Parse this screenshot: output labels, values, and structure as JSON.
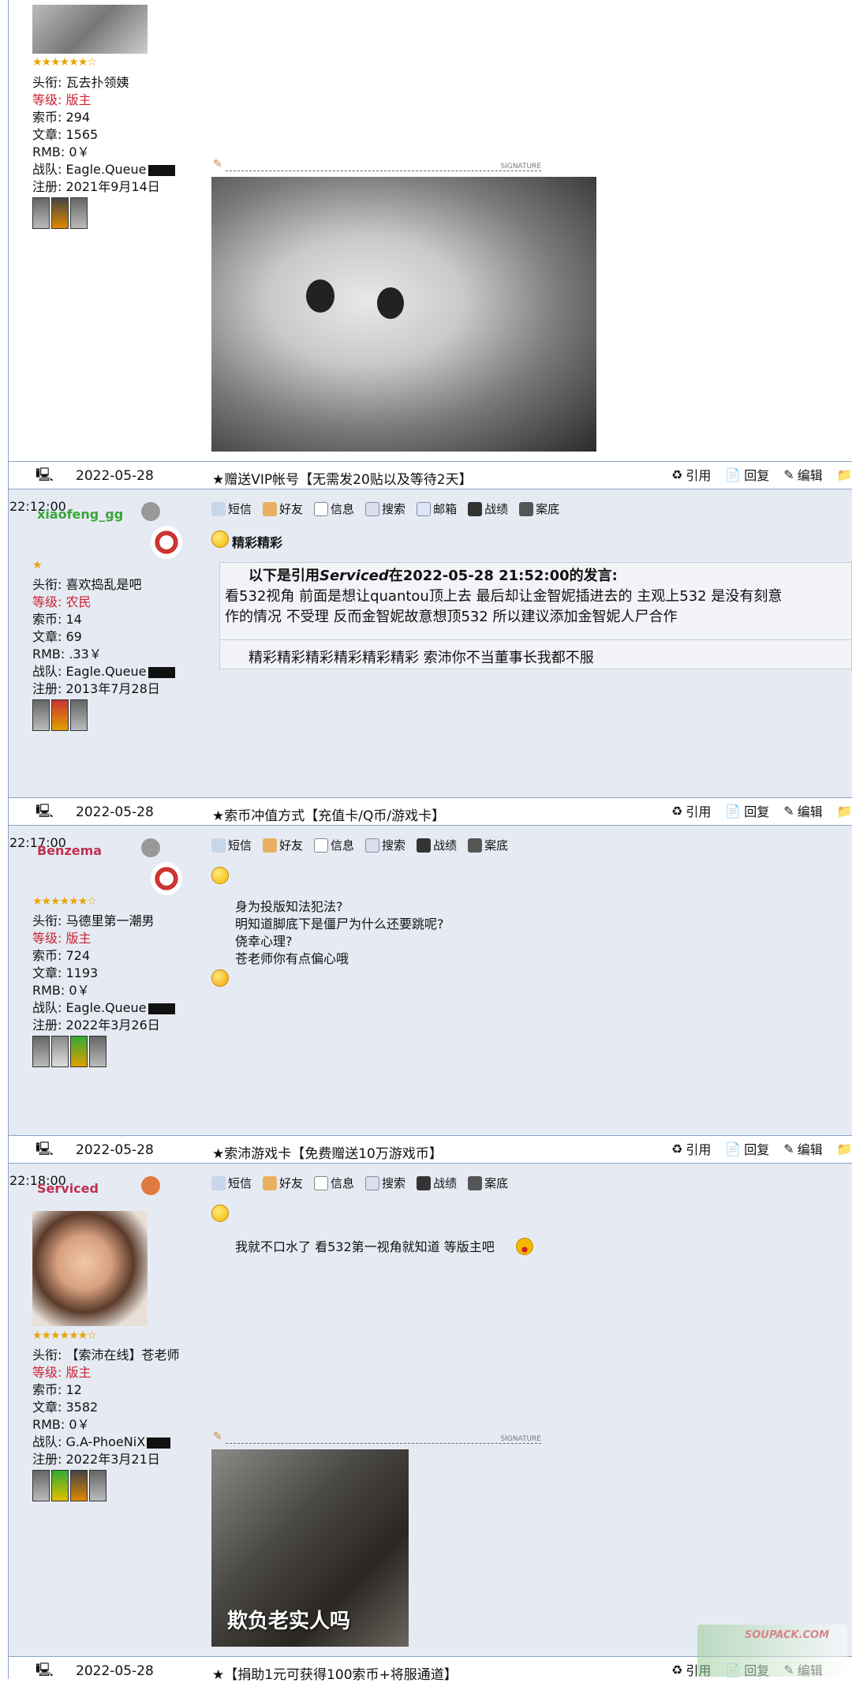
{
  "post0": {
    "stars": "★★★★★★☆",
    "info": {
      "title_label": "头衔:",
      "title_val": "瓦去扑领姨",
      "level_label": "等级:",
      "level_val": "版主",
      "coins_label": "索币:",
      "coins_val": "294",
      "posts_label": "文章:",
      "posts_val": "1565",
      "rmb_label": "RMB:",
      "rmb_val": "0￥",
      "team_label": "战队:",
      "team_val": "Eagle.Queue",
      "reg_label": "注册:",
      "reg_val": "2021年9月14日"
    },
    "sig_text": "SIGNATURE"
  },
  "bars": [
    {
      "date": "2022-05-28",
      "title": "★赠送VIP帐号【无需发20贴以及等待2天】"
    },
    {
      "date": "2022-05-28",
      "title": "★索币冲值方式【充值卡/Q币/游戏卡】"
    },
    {
      "date": "2022-05-28",
      "title": "★索沛游戏卡【免费赠送10万游戏币】"
    },
    {
      "date": "2022-05-28",
      "title": "★【捐助1元可获得100索币+将服通道】"
    }
  ],
  "actions": {
    "quote": "引用",
    "reply": "回复",
    "edit": "编辑"
  },
  "tools": {
    "sms": "短信",
    "friend": "好友",
    "info": "信息",
    "search": "搜索",
    "mail": "邮箱",
    "record": "战绩",
    "case": "案底"
  },
  "post1": {
    "time": "22:12:00",
    "username": "xiaofeng_gg",
    "stars": "★",
    "info": {
      "title_label": "头衔:",
      "title_val": "喜欢捣乱是吧",
      "level_label": "等级:",
      "level_val": "农民",
      "coins_label": "索币:",
      "coins_val": "14",
      "posts_label": "文章:",
      "posts_val": "69",
      "rmb_label": "RMB:",
      "rmb_val": ".33￥",
      "team_label": "战队:",
      "team_val": "Eagle.Queue",
      "reg_label": "注册:",
      "reg_val": "2013年7月28日"
    },
    "heading": "精彩精彩",
    "quote_head_a": "以下是引用",
    "quote_head_name": "Serviced",
    "quote_head_b": "在2022-05-28 21:52:00的发言:",
    "quote_line1": "看532视角  前面是想让quantou顶上去   最后却让金智妮插进去的    主观上532 是没有刻意",
    "quote_line2": "作的情况  不受理  反而金智妮故意想顶532  所以建议添加金智妮人尸合作",
    "reply_text": "精彩精彩精彩精彩精彩精彩  索沛你不当董事长我都不服"
  },
  "post2": {
    "time": "22:17:00",
    "username": "Benzema",
    "stars": "★★★★★★☆",
    "info": {
      "title_label": "头衔:",
      "title_val": "马德里第一潮男",
      "level_label": "等级:",
      "level_val": "版主",
      "coins_label": "索币:",
      "coins_val": "724",
      "posts_label": "文章:",
      "posts_val": "1193",
      "rmb_label": "RMB:",
      "rmb_val": "0￥",
      "team_label": "战队:",
      "team_val": "Eagle.Queue",
      "reg_label": "注册:",
      "reg_val": "2022年3月26日"
    },
    "line1": "身为投版知法犯法?",
    "line2": "明知道脚底下是僵尸为什么还要跳呢?",
    "line3": "侥幸心理?",
    "line4": "苍老师你有点偏心哦"
  },
  "post3": {
    "time": "22:18:00",
    "username": "Serviced",
    "stars": "★★★★★★☆",
    "info": {
      "title_label": "头衔:",
      "title_val": "【索沛在线】苍老师",
      "level_label": "等级:",
      "level_val": "版主",
      "coins_label": "索币:",
      "coins_val": "12",
      "posts_label": "文章:",
      "posts_val": "3582",
      "rmb_label": "RMB:",
      "rmb_val": "0￥",
      "team_label": "战队:",
      "team_val": "G.A-PhoeNiX",
      "reg_label": "注册:",
      "reg_val": "2022年3月21日"
    },
    "text": "我就不口水了  看532第一视角就知道  等版主吧",
    "caption": "欺负老实人吗",
    "sig_text": "SIGNATURE"
  },
  "watermark": "SOUPACK.COM"
}
